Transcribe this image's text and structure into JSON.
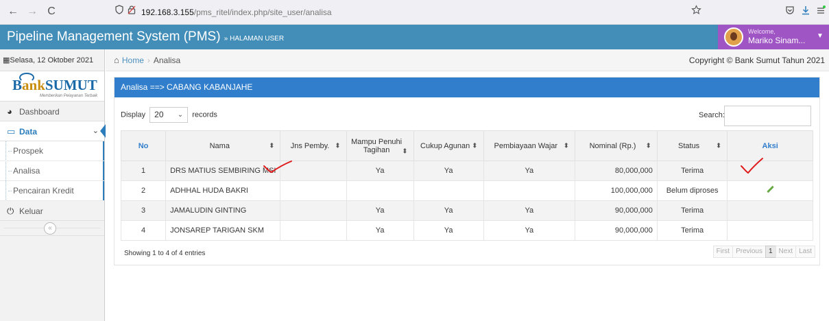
{
  "browser": {
    "back": "←",
    "forward": "→",
    "reload": "C",
    "url_host": "192.168.3.155",
    "url_path": "/pms_ritel/index.php/site_user/analisa"
  },
  "app": {
    "title": "Pipeline Management System (PMS)",
    "subtitle": "» HALAMAN USER",
    "welcome": "Welcome,",
    "user_name": "Mariko Sinam..."
  },
  "sidebar": {
    "date": "Selasa, 12 Oktober 2021",
    "logo_text_b": "B",
    "logo_text_ank": "ank",
    "logo_text_sumut": "SUMUT",
    "logo_slogan": "Memberikan Pelayanan Terbaik",
    "items": {
      "dashboard": "Dashboard",
      "data": "Data",
      "prospek": "Prospek",
      "analisa": "Analisa",
      "pencairan": "Pencairan Kredit",
      "keluar": "Keluar"
    },
    "collapse": "«"
  },
  "breadcrumb": {
    "home": "Home",
    "current": "Analisa",
    "copyright": "Copyright © Bank Sumut Tahun 2021"
  },
  "panel": {
    "header": "Analisa ==> CABANG KABANJAHE",
    "display_label": "Display",
    "display_value": "20",
    "records_label": "records",
    "search_label": "Search:",
    "showing": "Showing 1 to 4 of 4 entries"
  },
  "table": {
    "headers": {
      "no": "No",
      "nama": "Nama",
      "jns": "Jns Pemby.",
      "mampu": "Mampu Penuhi Tagihan",
      "cukup": "Cukup Agunan",
      "wajar": "Pembiayaan Wajar",
      "nominal": "Nominal (Rp.)",
      "status": "Status",
      "aksi": "Aksi"
    },
    "rows": [
      {
        "no": "1",
        "nama": "DRS MATIUS SEMBIRING MSI",
        "jns": "",
        "mampu": "Ya",
        "cukup": "Ya",
        "wajar": "Ya",
        "nominal": "80,000,000",
        "status": "Terima"
      },
      {
        "no": "2",
        "nama": "ADHHAL HUDA BAKRI",
        "jns": "",
        "mampu": "",
        "cukup": "",
        "wajar": "",
        "nominal": "100,000,000",
        "status": "Belum diproses"
      },
      {
        "no": "3",
        "nama": "JAMALUDIN GINTING",
        "jns": "",
        "mampu": "Ya",
        "cukup": "Ya",
        "wajar": "Ya",
        "nominal": "90,000,000",
        "status": "Terima"
      },
      {
        "no": "4",
        "nama": "JONSAREP TARIGAN SKM",
        "jns": "",
        "mampu": "Ya",
        "cukup": "Ya",
        "wajar": "Ya",
        "nominal": "90,000,000",
        "status": "Terima"
      }
    ]
  },
  "pager": {
    "first": "First",
    "previous": "Previous",
    "page": "1",
    "next": "Next",
    "last": "Last"
  },
  "colors": {
    "appbar": "#438eb9",
    "panel_header": "#307ecc",
    "user_box": "#9f55c4",
    "edit_icon": "#69aa46",
    "annotation": "#e01b1b"
  }
}
